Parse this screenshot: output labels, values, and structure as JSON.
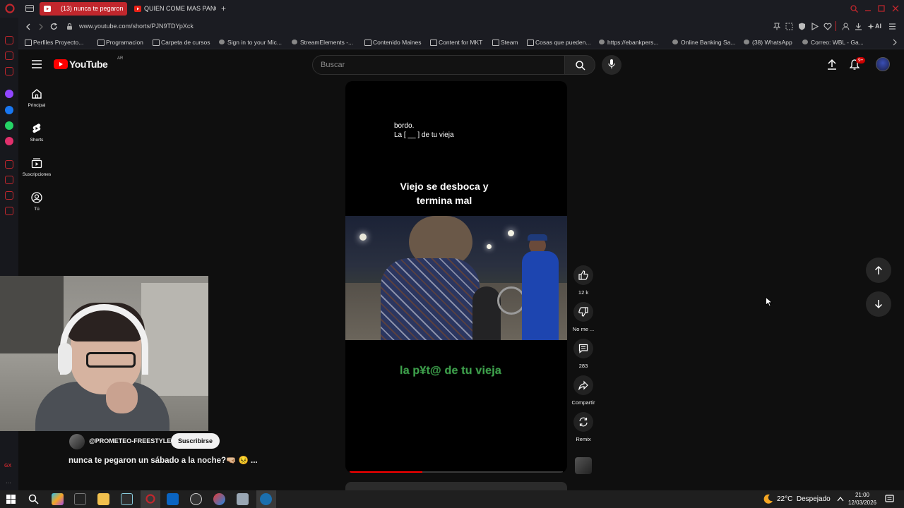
{
  "browser": {
    "tabs": [
      {
        "title": "(13) nunca te pegaron",
        "active": true
      },
      {
        "title": "QUIEN COME MAS PANC",
        "active": false
      }
    ],
    "new_tab": "+",
    "url": "www.youtube.com/shorts/PJN9TDYpXck",
    "ai_label": "AI",
    "bookmarks": [
      "Perfiles Proyecto...",
      "Programacion",
      "Carpeta de cursos",
      "Sign in to your Mic...",
      "StreamElements -...",
      "Contenido Maines",
      "Content for MKT",
      "Steam",
      "Cosas que pueden...",
      "https://ebankpers...",
      "Online Banking Sa...",
      "(38) WhatsApp",
      "Correo: WBL - Ga..."
    ],
    "whatsapp_badge": "38",
    "gx_label": "GX",
    "sidebar_icon_colors": [
      "#c1272d",
      "#c1272d",
      "#c1272d",
      "#9146ff",
      "#1877f2",
      "#25d366",
      "#e1306c",
      "#c1272d",
      "#c1272d",
      "#c1272d",
      "#c1272d"
    ]
  },
  "youtube": {
    "logo_text": "YouTube",
    "country": "AR",
    "search_placeholder": "Buscar",
    "notification_count": "9+",
    "nav": [
      {
        "label": "Principal",
        "icon": "home-icon"
      },
      {
        "label": "Shorts",
        "icon": "shorts-icon"
      },
      {
        "label": "Suscripciones",
        "icon": "subscriptions-icon"
      },
      {
        "label": "Tú",
        "icon": "you-icon"
      }
    ],
    "video": {
      "caption_top_line1": "bordo.",
      "caption_top_line2": "La [ __ ] de tu vieja",
      "title_line1": "Viejo se desboca y",
      "title_line2": "termina mal",
      "caption_bottom": "la p¥t@ de tu vieja",
      "progress": 0.34
    },
    "actions": [
      {
        "label": "12 k",
        "icon": "like-icon"
      },
      {
        "label": "No me ...",
        "icon": "dislike-icon"
      },
      {
        "label": "283",
        "icon": "comment-icon"
      },
      {
        "label": "Compartir",
        "icon": "share-icon"
      },
      {
        "label": "Remix",
        "icon": "remix-icon"
      }
    ],
    "channel": "@PROMETEO-FREESTYLE",
    "subscribe_label": "Suscribirse",
    "short_title": "nunca te pegaron un sábado a la noche?🤜🏼 😣 ..."
  },
  "taskbar": {
    "weather": "22°C  Despejado",
    "time": "21:00",
    "date": "12/03/2026"
  },
  "colors": {
    "accent": "#c1272d",
    "youtube_red": "#ff0000",
    "caption_green": "#3fa34d"
  }
}
